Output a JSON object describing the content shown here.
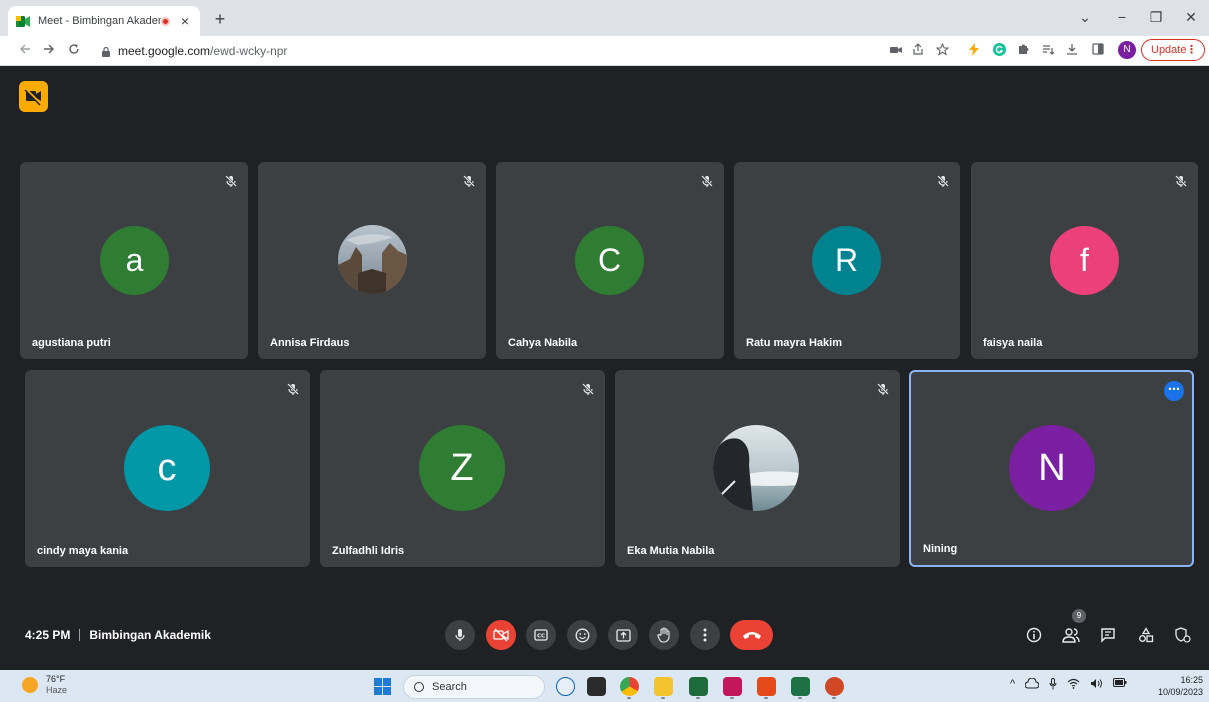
{
  "browser": {
    "tab_title": "Meet - Bimbingan Akademik",
    "tab_close": "×",
    "new_tab": "+",
    "window_min": "−",
    "window_restore": "❐",
    "window_close": "✕",
    "tab_list": "⌄",
    "url_host": "meet.google.com",
    "url_path": "/ewd-wcky-npr",
    "profile_initial": "N",
    "update_label": "Update",
    "update_menu": "⋮"
  },
  "participants": [
    {
      "name": "agustiana putri",
      "initial": "a",
      "color": "#2e7d32",
      "muted": true
    },
    {
      "name": "Annisa Firdaus",
      "initial": "",
      "color": "photo",
      "muted": true
    },
    {
      "name": "Cahya Nabila",
      "initial": "C",
      "color": "#2e7d32",
      "muted": true
    },
    {
      "name": "Ratu mayra Hakim",
      "initial": "R",
      "color": "#00838f",
      "muted": true
    },
    {
      "name": "faisya naila",
      "initial": "f",
      "color": "#ec407a",
      "muted": true
    },
    {
      "name": "cindy maya kania",
      "initial": "c",
      "color": "#0097a7",
      "muted": true
    },
    {
      "name": "Zulfadhli Idris",
      "initial": "Z",
      "color": "#2e7d32",
      "muted": true
    },
    {
      "name": "Eka Mutia Nabila",
      "initial": "",
      "color": "photo",
      "muted": true
    },
    {
      "name": "Nining",
      "initial": "N",
      "color": "#7b1fa2",
      "muted": false
    }
  ],
  "footer": {
    "time": "4:25 PM",
    "meeting_title": "Bimbingan Akademik",
    "people_count": "9",
    "more_options": "⋯"
  },
  "taskbar": {
    "temperature": "76°F",
    "weather": "Haze",
    "search_label": "Search",
    "clock_time": "16:25",
    "clock_date": "10/09/2023",
    "tray_chevron": "^"
  }
}
